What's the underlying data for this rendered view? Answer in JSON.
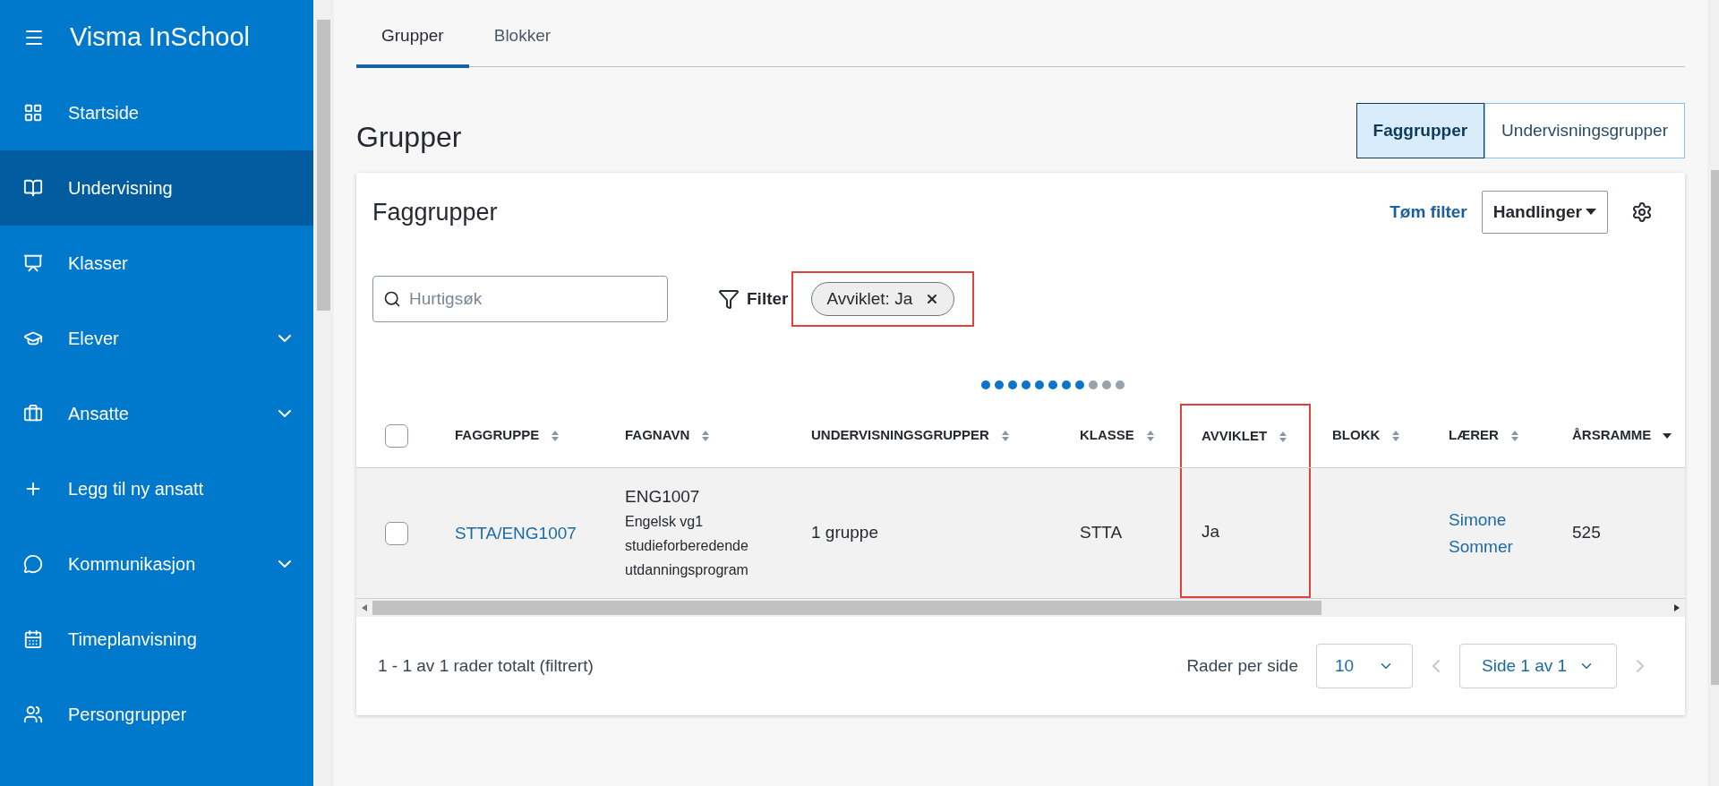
{
  "sidebar": {
    "title": "Visma InSchool",
    "items": [
      {
        "label": "Startside",
        "selected": false,
        "expandable": false
      },
      {
        "label": "Undervisning",
        "selected": true,
        "expandable": false
      },
      {
        "label": "Klasser",
        "selected": false,
        "expandable": false
      },
      {
        "label": "Elever",
        "selected": false,
        "expandable": true
      },
      {
        "label": "Ansatte",
        "selected": false,
        "expandable": true
      },
      {
        "label": "Legg til ny ansatt",
        "selected": false,
        "expandable": false
      },
      {
        "label": "Kommunikasjon",
        "selected": false,
        "expandable": true
      },
      {
        "label": "Timeplanvisning",
        "selected": false,
        "expandable": false
      },
      {
        "label": "Persongrupper",
        "selected": false,
        "expandable": false
      }
    ]
  },
  "tabs": [
    {
      "label": "Grupper",
      "selected": true
    },
    {
      "label": "Blokker",
      "selected": false
    }
  ],
  "page_title": "Grupper",
  "toggle": [
    {
      "label": "Faggrupper",
      "selected": true
    },
    {
      "label": "Undervisningsgrupper",
      "selected": false
    }
  ],
  "card": {
    "title": "Faggrupper",
    "clear_filter": "Tøm filter",
    "actions": "Handlinger",
    "search": {
      "placeholder": "Hurtigsøk"
    },
    "filter_label": "Filter",
    "chips": [
      {
        "label": "Avviklet: Ja",
        "highlighted": true
      }
    ],
    "column_pager": [
      {
        "active": true
      },
      {
        "active": true
      },
      {
        "active": true
      },
      {
        "active": true
      },
      {
        "active": true
      },
      {
        "active": true
      },
      {
        "active": true
      },
      {
        "active": true
      },
      {
        "active": false
      },
      {
        "active": false
      },
      {
        "active": false
      }
    ],
    "table": {
      "select_all_checked": false,
      "columns": [
        {
          "label": "FAGGRUPPE",
          "sorted": false,
          "highlighted": false
        },
        {
          "label": "FAGNAVN",
          "sorted": false,
          "highlighted": false
        },
        {
          "label": "UNDERVISNINGSGRUPPER",
          "sorted": false,
          "highlighted": false
        },
        {
          "label": "KLASSE",
          "sorted": false,
          "highlighted": false
        },
        {
          "label": "AVVIKLET",
          "sorted": false,
          "highlighted": true
        },
        {
          "label": "BLOKK",
          "sorted": false,
          "highlighted": false
        },
        {
          "label": "LÆRER",
          "sorted": false,
          "highlighted": false
        },
        {
          "label": "ÅRSRAMME",
          "sorted": true,
          "highlighted": false
        }
      ],
      "rows": [
        {
          "checked": false,
          "cells": [
            {
              "kind": "link",
              "lines": [
                "STTA/ENG1007"
              ]
            },
            {
              "kind": "subject",
              "lines": [
                "ENG1007",
                "Engelsk vg1",
                "studieforberedende",
                "utdanningsprogram"
              ]
            },
            {
              "kind": "text",
              "lines": [
                "1 gruppe"
              ]
            },
            {
              "kind": "text",
              "lines": [
                "STTA"
              ]
            },
            {
              "kind": "text",
              "lines": [
                "Ja"
              ]
            },
            {
              "kind": "empty"
            },
            {
              "kind": "link",
              "lines": [
                "Simone",
                "Sommer"
              ]
            },
            {
              "kind": "text",
              "lines": [
                "525"
              ]
            }
          ]
        }
      ]
    },
    "footer": {
      "summary": "1 - 1 av 1 rader totalt (filtrert)",
      "rows_per_page_label": "Rader per side",
      "rows_per_page": "10",
      "page": "Side 1 av 1"
    }
  }
}
